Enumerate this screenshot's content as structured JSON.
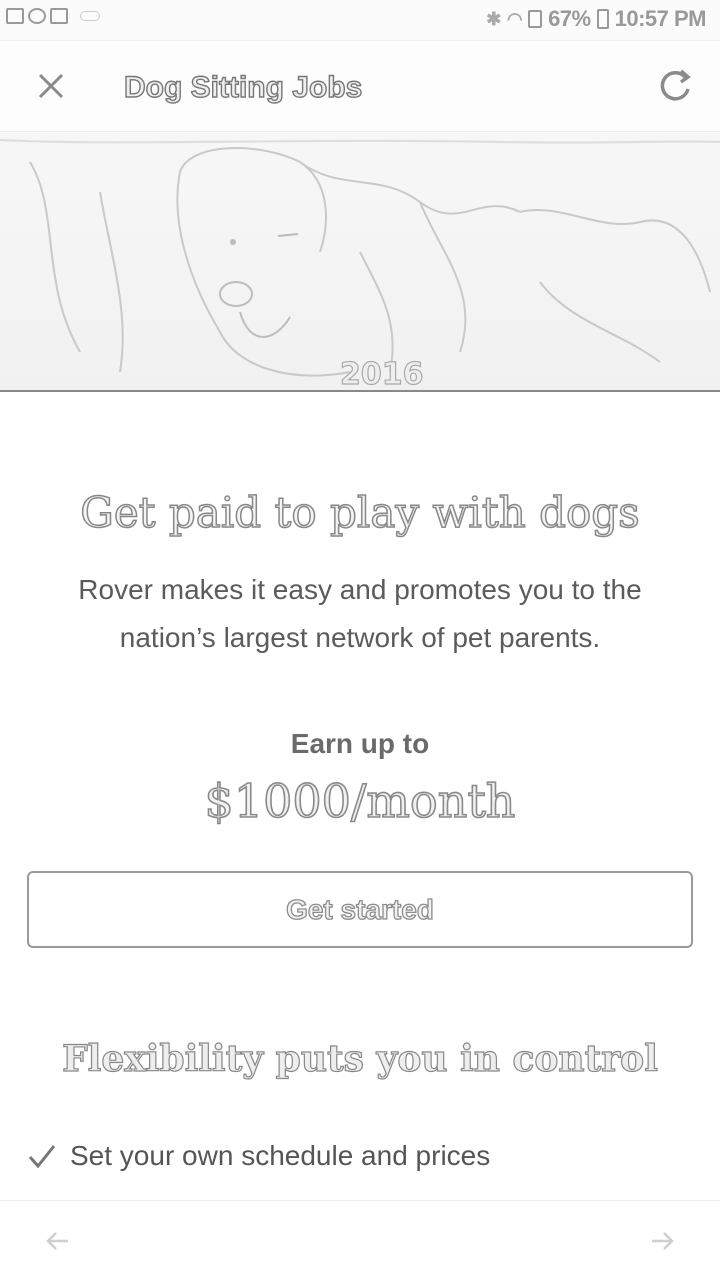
{
  "status_bar": {
    "battery": "67%",
    "time": "10:57 PM"
  },
  "app_bar": {
    "title": "Dog Sitting Jobs"
  },
  "hero": {
    "sign_text": "2016"
  },
  "content": {
    "headline": "Get paid to play with dogs",
    "subtext": "Rover makes it easy and promotes you to the nation’s largest network of pet parents.",
    "earn_label": "Earn up to",
    "earn_amount": "$1000/month",
    "cta_label": "Get started",
    "section_title": "Flexibility puts you in control",
    "checklist": [
      "Set your own schedule and prices"
    ]
  },
  "icons": {
    "close": "close-icon",
    "refresh": "refresh-icon",
    "check": "check-icon",
    "back": "arrow-left-icon",
    "forward": "arrow-right-icon"
  }
}
